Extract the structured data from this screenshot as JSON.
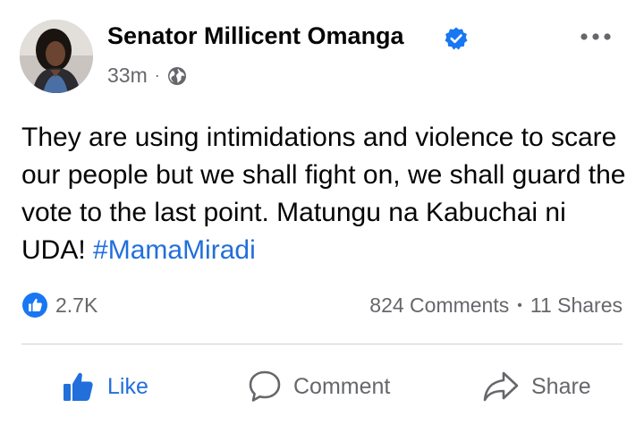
{
  "post": {
    "author_name": "Senator Millicent Omanga",
    "timestamp": "33m",
    "meta_separator": "·",
    "visibility_icon": "globe-icon",
    "verified_icon": "verified-badge-icon",
    "text": "They are using intimidations and violence to scare our people but we shall fight on, we shall guard the vote to the last point. Matungu na Kabuchai ni UDA!",
    "hashtag": "#MamaMiradi"
  },
  "stats": {
    "reaction_icon": "like-reaction-icon",
    "reaction_count": "2.7K",
    "comments": "824 Comments",
    "separator": "•",
    "shares": "11 Shares"
  },
  "actions": {
    "like_label": "Like",
    "comment_label": "Comment",
    "share_label": "Share"
  },
  "colors": {
    "accent": "#216fdb",
    "verified": "#1877f2",
    "secondary_text": "#65676b",
    "primary_text": "#050505"
  }
}
